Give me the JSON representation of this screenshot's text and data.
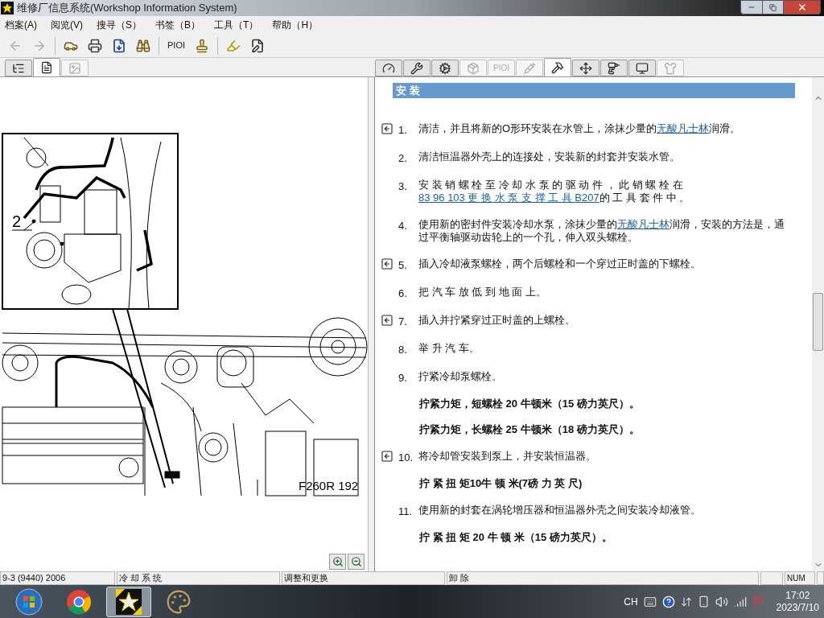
{
  "window": {
    "title": "维修厂信息系统(Workshop Information System)"
  },
  "menu": [
    "档案(A)",
    "阅览(V)",
    "搜寻（S）",
    "书签（B）",
    "工具（T）",
    "帮助（H）"
  ],
  "toolbar": [
    {
      "kind": "icon",
      "disabled": true
    },
    {
      "kind": "icon",
      "disabled": true
    },
    {
      "kind": "separator"
    },
    {
      "kind": "icon",
      "disabled": false
    },
    {
      "kind": "icon",
      "disabled": false
    },
    {
      "kind": "icon",
      "disabled": false
    },
    {
      "kind": "icon",
      "disabled": false
    },
    {
      "kind": "separator"
    },
    {
      "kind": "text",
      "label": "PIOI",
      "disabled": false
    },
    {
      "kind": "icon",
      "disabled": false
    },
    {
      "kind": "separator"
    },
    {
      "kind": "icon",
      "disabled": false
    },
    {
      "kind": "icon",
      "disabled": false
    }
  ],
  "left_tabs": [
    {
      "selected": false,
      "disabled": false
    },
    {
      "selected": true,
      "disabled": false
    },
    {
      "selected": false,
      "disabled": true
    }
  ],
  "right_tabs": [
    {
      "kind": "icon",
      "selected": false,
      "disabled": false
    },
    {
      "kind": "icon",
      "selected": false,
      "disabled": false
    },
    {
      "kind": "icon",
      "selected": false,
      "disabled": false
    },
    {
      "kind": "icon",
      "selected": false,
      "disabled": true
    },
    {
      "kind": "text",
      "label": "PIOI",
      "selected": false,
      "disabled": true
    },
    {
      "kind": "icon",
      "selected": false,
      "disabled": true
    },
    {
      "kind": "icon",
      "selected": true,
      "disabled": false
    },
    {
      "kind": "icon",
      "selected": false,
      "disabled": false
    },
    {
      "kind": "icon",
      "selected": false,
      "disabled": false
    },
    {
      "kind": "icon",
      "selected": false,
      "disabled": false
    },
    {
      "kind": "icon",
      "selected": false,
      "disabled": true
    }
  ],
  "figure": {
    "callout": "2",
    "code": "F260R 192"
  },
  "section": {
    "heading": "安 装",
    "steps": [
      {
        "number": "1.",
        "jump": true,
        "segments": [
          {
            "kind": "text",
            "text": "清洁，并且将新的O形环安装在水管上，涂抹少量的"
          },
          {
            "kind": "link",
            "text": "无酸凡士林"
          },
          {
            "kind": "text",
            "text": "润滑。"
          }
        ]
      },
      {
        "number": "2.",
        "jump": false,
        "segments": [
          {
            "kind": "text",
            "text": "清洁恒温器外壳上的连接处，安装新的封套并安装水管。"
          }
        ]
      },
      {
        "number": "3.",
        "jump": false,
        "segments": [
          {
            "kind": "text",
            "text": "安 装 销 螺 栓 至 冷 却 水 泵 的 驱 动 件 ， 此 销 螺 栓 在 "
          },
          {
            "kind": "link",
            "text": "83 96 103 更 换 水 泵 支 撑 工 具 B207"
          },
          {
            "kind": "text",
            "text": "的 工 具 套 件 中 。"
          }
        ]
      },
      {
        "number": "4.",
        "jump": false,
        "segments": [
          {
            "kind": "text",
            "text": "使用新的密封件安装冷却水泵，涂抹少量的"
          },
          {
            "kind": "link",
            "text": "无酸凡士林"
          },
          {
            "kind": "text",
            "text": "润滑，安装的方法是，通过平衡轴驱动齿轮上的一个孔，伸入双头螺栓。"
          }
        ]
      },
      {
        "number": "5.",
        "jump": true,
        "segments": [
          {
            "kind": "text",
            "text": "插入冷却液泵螺栓，两个后螺栓和一个穿过正时盖的下螺栓。"
          }
        ]
      },
      {
        "number": "6.",
        "jump": false,
        "segments": [
          {
            "kind": "text",
            "text": "把 汽 车 放 低 到 地 面 上。"
          }
        ]
      },
      {
        "number": "7.",
        "jump": true,
        "segments": [
          {
            "kind": "text",
            "text": "插入并拧紧穿过正时盖的上螺栓。"
          }
        ]
      },
      {
        "number": "8.",
        "jump": false,
        "segments": [
          {
            "kind": "text",
            "text": "举 升 汽 车。"
          }
        ]
      },
      {
        "number": "9.",
        "jump": false,
        "segments": [
          {
            "kind": "text",
            "text": "拧紧冷却泵螺栓。"
          }
        ],
        "notes": [
          "拧紧力矩，短螺栓 20 牛顿米（15 磅力英尺）。",
          "拧紧力矩，长螺栓 25 牛顿米（18 磅力英尺）。"
        ]
      },
      {
        "number": "10.",
        "jump": true,
        "segments": [
          {
            "kind": "text",
            "text": "将冷却管安装到泵上，并安装恒温器。"
          }
        ],
        "notes": [
          "拧 紧 扭 矩10牛 顿 米(7磅 力 英 尺)"
        ]
      },
      {
        "number": "11.",
        "jump": false,
        "segments": [
          {
            "kind": "text",
            "text": "使用新的封套在涡轮增压器和恒温器外壳之间安装冷却液管。"
          }
        ],
        "notes": [
          "拧 紧 扭 矩 20 牛 顿 米（15 磅力英尺）。"
        ]
      }
    ]
  },
  "status_bar": [
    "9-3 (9440) 2006",
    "冷 却 系 统",
    "调整和更换",
    "卸 除",
    "NUM"
  ],
  "taskbar": {
    "apps": [
      {
        "selected": false
      },
      {
        "selected": false
      },
      {
        "selected": true
      },
      {
        "selected": false
      }
    ],
    "tray": {
      "input": "CH",
      "time": "17:02",
      "date": "2023/7/10"
    }
  }
}
